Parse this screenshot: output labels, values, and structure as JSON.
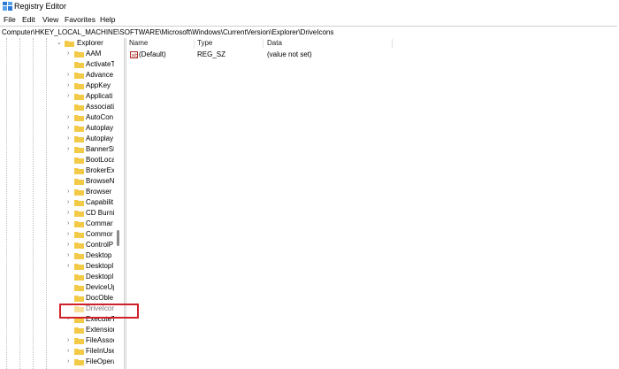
{
  "window": {
    "title": "Registry Editor"
  },
  "menu": [
    "File",
    "Edit",
    "View",
    "Favorites",
    "Help"
  ],
  "address": "Computer\\HKEY_LOCAL_MACHINE\\SOFTWARE\\Microsoft\\Windows\\CurrentVersion\\Explorer\\DriveIcons",
  "tree": {
    "parent": "Explorer",
    "items": [
      {
        "label": "AAM",
        "expandable": true
      },
      {
        "label": "ActivateT",
        "expandable": false
      },
      {
        "label": "Advance",
        "expandable": true
      },
      {
        "label": "AppKey",
        "expandable": true
      },
      {
        "label": "Applicati",
        "expandable": true
      },
      {
        "label": "Associati",
        "expandable": false
      },
      {
        "label": "AutoCon",
        "expandable": true
      },
      {
        "label": "Autoplay",
        "expandable": true
      },
      {
        "label": "Autoplay",
        "expandable": true
      },
      {
        "label": "BannerSt",
        "expandable": true
      },
      {
        "label": "BootLoca",
        "expandable": false
      },
      {
        "label": "BrokerEx",
        "expandable": false
      },
      {
        "label": "BrowseN",
        "expandable": false
      },
      {
        "label": "Browser",
        "expandable": true
      },
      {
        "label": "Capabilit",
        "expandable": true
      },
      {
        "label": "CD Burni",
        "expandable": true
      },
      {
        "label": "Commar",
        "expandable": true
      },
      {
        "label": "Commor",
        "expandable": true
      },
      {
        "label": "ControlP",
        "expandable": true
      },
      {
        "label": "Desktop",
        "expandable": true
      },
      {
        "label": "Desktopl",
        "expandable": true
      },
      {
        "label": "Desktopl",
        "expandable": false
      },
      {
        "label": "DeviceUp",
        "expandable": false
      },
      {
        "label": "DocOble",
        "expandable": false
      },
      {
        "label": "DriveIcons",
        "expandable": false,
        "selected": true
      },
      {
        "label": "ExecuteT",
        "expandable": true
      },
      {
        "label": "Extensior",
        "expandable": false
      },
      {
        "label": "FileAssoc",
        "expandable": true
      },
      {
        "label": "FileInUse",
        "expandable": true
      },
      {
        "label": "FileOpera",
        "expandable": true
      }
    ]
  },
  "list": {
    "columns": [
      "Name",
      "Type",
      "Data"
    ],
    "rows": [
      {
        "name": "(Default)",
        "type": "REG_SZ",
        "data": "(value not set)"
      }
    ]
  },
  "colors": {
    "folder": "#f3c948",
    "highlight": "#d0202a"
  }
}
